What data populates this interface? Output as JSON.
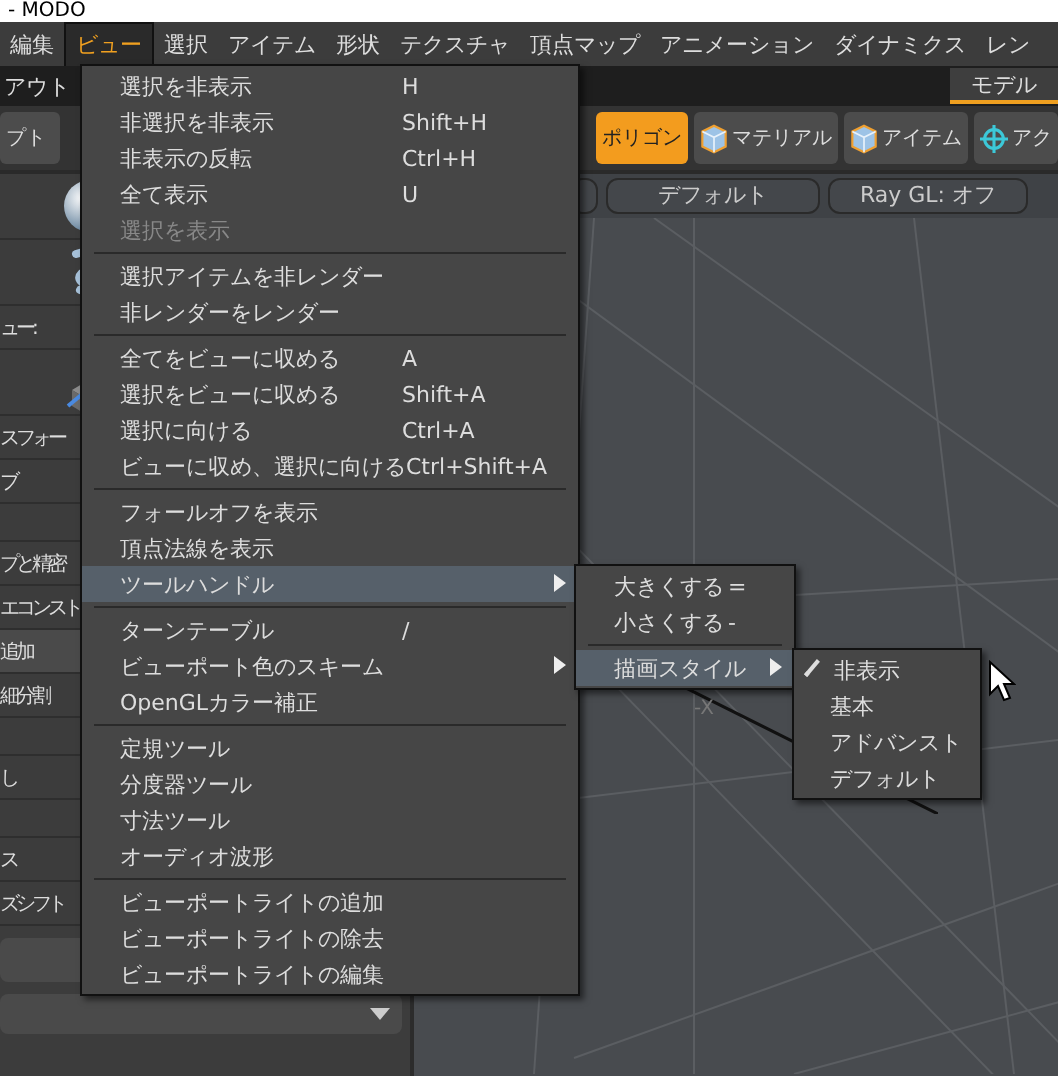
{
  "window": {
    "title": "- MODO"
  },
  "menubar": [
    {
      "label": "編集",
      "selected": false
    },
    {
      "label": "ビュー",
      "selected": true
    },
    {
      "label": "選択",
      "selected": false
    },
    {
      "label": "アイテム",
      "selected": false
    },
    {
      "label": "形状",
      "selected": false
    },
    {
      "label": "テクスチャ",
      "selected": false
    },
    {
      "label": "頂点マップ",
      "selected": false
    },
    {
      "label": "アニメーション",
      "selected": false
    },
    {
      "label": "ダイナミクス",
      "selected": false
    },
    {
      "label": "レン",
      "selected": false
    }
  ],
  "layout_bar": {
    "label": "アウト",
    "tab": "モデル"
  },
  "toolbar": {
    "left_button": "プト",
    "buttons": [
      {
        "label": "ポリゴン",
        "selected": true
      },
      {
        "label": "マテリアル",
        "selected": false
      },
      {
        "label": "アイテム",
        "selected": false
      },
      {
        "label": "アク",
        "selected": false
      }
    ]
  },
  "viewport": {
    "header_buttons": [
      "デフォルト",
      "Ray GL: オフ"
    ],
    "axis_label": "-X"
  },
  "left_panel": [
    {
      "kind": "icon"
    },
    {
      "kind": "icon"
    },
    {
      "kind": "text",
      "label": "ュー:"
    },
    {
      "kind": "icon"
    },
    {
      "kind": "text",
      "label": "スフォー"
    },
    {
      "kind": "text",
      "label": "ブ"
    },
    {
      "kind": "gap"
    },
    {
      "kind": "text",
      "label": "プと精密"
    },
    {
      "kind": "text",
      "label": "エコンスト"
    },
    {
      "kind": "text",
      "label": "追加",
      "selected": true
    },
    {
      "kind": "text",
      "label": "細分割"
    },
    {
      "kind": "gap"
    },
    {
      "kind": "text",
      "label": "し"
    },
    {
      "kind": "gap"
    },
    {
      "kind": "text",
      "label": "ス"
    },
    {
      "kind": "text",
      "label": "ズシフト"
    }
  ],
  "view_menu": [
    [
      {
        "label": "選択を非表示",
        "shortcut": "H",
        "disabled": false,
        "selected": false,
        "submenu": false
      },
      {
        "label": "非選択を非表示",
        "shortcut": "Shift+H",
        "disabled": false,
        "selected": false,
        "submenu": false
      },
      {
        "label": "非表示の反転",
        "shortcut": "Ctrl+H",
        "disabled": false,
        "selected": false,
        "submenu": false
      },
      {
        "label": "全て表示",
        "shortcut": "U",
        "disabled": false,
        "selected": false,
        "submenu": false
      },
      {
        "label": "選択を表示",
        "disabled": true,
        "selected": false,
        "submenu": false
      }
    ],
    [
      {
        "label": "選択アイテムを非レンダー",
        "disabled": false,
        "selected": false,
        "submenu": false
      },
      {
        "label": "非レンダーをレンダー",
        "disabled": false,
        "selected": false,
        "submenu": false
      }
    ],
    [
      {
        "label": "全てをビューに収める",
        "shortcut": "A",
        "disabled": false,
        "selected": false,
        "submenu": false
      },
      {
        "label": "選択をビューに収める",
        "shortcut": "Shift+A",
        "disabled": false,
        "selected": false,
        "submenu": false
      },
      {
        "label": "選択に向ける",
        "shortcut": "Ctrl+A",
        "disabled": false,
        "selected": false,
        "submenu": false
      },
      {
        "label": "ビューに収め、選択に向ける",
        "shortcut": "Ctrl+Shift+A",
        "disabled": false,
        "selected": false,
        "submenu": false
      }
    ],
    [
      {
        "label": "フォールオフを表示",
        "disabled": false,
        "selected": false,
        "submenu": false
      },
      {
        "label": "頂点法線を表示",
        "disabled": false,
        "selected": false,
        "submenu": false
      },
      {
        "label": "ツールハンドル",
        "disabled": false,
        "selected": true,
        "submenu": true
      }
    ],
    [
      {
        "label": "ターンテーブル",
        "shortcut": "/",
        "disabled": false,
        "selected": false,
        "submenu": false
      },
      {
        "label": "ビューポート色のスキーム",
        "disabled": false,
        "selected": false,
        "submenu": true
      },
      {
        "label": "OpenGLカラー補正",
        "disabled": false,
        "selected": false,
        "submenu": false
      }
    ],
    [
      {
        "label": "定規ツール",
        "disabled": false,
        "selected": false,
        "submenu": false
      },
      {
        "label": "分度器ツール",
        "disabled": false,
        "selected": false,
        "submenu": false
      },
      {
        "label": "寸法ツール",
        "disabled": false,
        "selected": false,
        "submenu": false
      },
      {
        "label": "オーディオ波形",
        "disabled": false,
        "selected": false,
        "submenu": false
      }
    ],
    [
      {
        "label": "ビューポートライトの追加",
        "disabled": false,
        "selected": false,
        "submenu": false
      },
      {
        "label": "ビューポートライトの除去",
        "disabled": false,
        "selected": false,
        "submenu": false
      },
      {
        "label": "ビューポートライトの編集",
        "disabled": false,
        "selected": false,
        "submenu": false
      }
    ]
  ],
  "tool_handle_menu": [
    [
      {
        "label": "大きくする",
        "shortcut": "=",
        "selected": false,
        "submenu": false
      },
      {
        "label": "小さくする",
        "shortcut": "-",
        "selected": false,
        "submenu": false
      }
    ],
    [
      {
        "label": "描画スタイル",
        "selected": true,
        "submenu": true
      }
    ]
  ],
  "draw_style_menu": [
    {
      "label": "非表示",
      "checked": true
    },
    {
      "label": "基本",
      "checked": false
    },
    {
      "label": "アドバンスト",
      "checked": false
    },
    {
      "label": "デフォルト",
      "checked": false
    }
  ]
}
